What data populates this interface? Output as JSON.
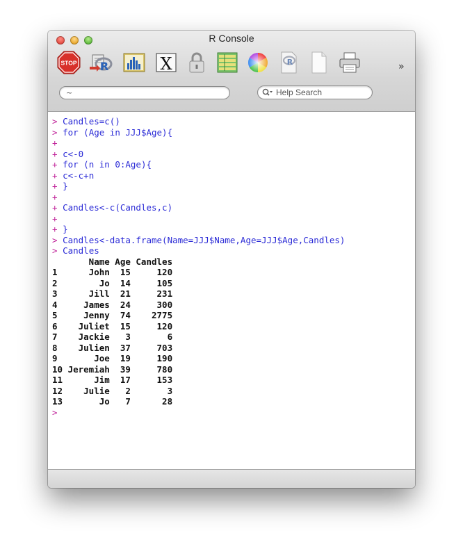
{
  "window": {
    "title": "R Console"
  },
  "toolbar": {
    "overflow_label": "»",
    "buttons": [
      {
        "name": "stop-button",
        "icon": "stop-sign-icon",
        "label": "STOP"
      },
      {
        "name": "source-script-button",
        "icon": "r-script-icon"
      },
      {
        "name": "quartz-button",
        "icon": "chart-icon"
      },
      {
        "name": "x11-button",
        "icon": "x11-icon",
        "label": "X"
      },
      {
        "name": "authorize-button",
        "icon": "lock-icon"
      },
      {
        "name": "data-editor-button",
        "icon": "data-table-icon"
      },
      {
        "name": "color-button",
        "icon": "color-wheel-icon"
      },
      {
        "name": "open-document-button",
        "icon": "r-document-icon"
      },
      {
        "name": "new-document-button",
        "icon": "blank-document-icon"
      },
      {
        "name": "print-button",
        "icon": "printer-icon"
      }
    ]
  },
  "pathbar": {
    "value": "~"
  },
  "search": {
    "placeholder": "Help Search"
  },
  "colors": {
    "prompt": "#c0249a",
    "input": "#2a2ad6",
    "output": "#111111",
    "stop_red": "#d8302a"
  },
  "console": {
    "lines": [
      {
        "prompt": ">",
        "text": "Candles=c()",
        "type": "input"
      },
      {
        "prompt": ">",
        "text": "for (Age in JJJ$Age){",
        "type": "input"
      },
      {
        "prompt": "+",
        "text": "",
        "type": "input"
      },
      {
        "prompt": "+",
        "text": "c<-0",
        "type": "input"
      },
      {
        "prompt": "+",
        "text": "for (n in 0:Age){",
        "type": "input"
      },
      {
        "prompt": "+",
        "text": "c<-c+n",
        "type": "input"
      },
      {
        "prompt": "+",
        "text": "}",
        "type": "input"
      },
      {
        "prompt": "+",
        "text": "",
        "type": "input"
      },
      {
        "prompt": "+",
        "text": "Candles<-c(Candles,c)",
        "type": "input"
      },
      {
        "prompt": "+",
        "text": "",
        "type": "input"
      },
      {
        "prompt": "+",
        "text": "}",
        "type": "input"
      },
      {
        "prompt": ">",
        "text": "Candles<-data.frame(Name=JJJ$Name,Age=JJJ$Age,Candles)",
        "type": "input"
      },
      {
        "prompt": ">",
        "text": "Candles",
        "type": "input"
      },
      {
        "prompt": "",
        "text": "       Name Age Candles",
        "type": "output"
      },
      {
        "prompt": "",
        "text": "1      John  15     120",
        "type": "output"
      },
      {
        "prompt": "",
        "text": "2        Jo  14     105",
        "type": "output"
      },
      {
        "prompt": "",
        "text": "3      Jill  21     231",
        "type": "output"
      },
      {
        "prompt": "",
        "text": "4     James  24     300",
        "type": "output"
      },
      {
        "prompt": "",
        "text": "5     Jenny  74    2775",
        "type": "output"
      },
      {
        "prompt": "",
        "text": "6    Juliet  15     120",
        "type": "output"
      },
      {
        "prompt": "",
        "text": "7    Jackie   3       6",
        "type": "output"
      },
      {
        "prompt": "",
        "text": "8    Julien  37     703",
        "type": "output"
      },
      {
        "prompt": "",
        "text": "9       Joe  19     190",
        "type": "output"
      },
      {
        "prompt": "",
        "text": "10 Jeremiah  39     780",
        "type": "output"
      },
      {
        "prompt": "",
        "text": "11      Jim  17     153",
        "type": "output"
      },
      {
        "prompt": "",
        "text": "12    Julie   2       3",
        "type": "output"
      },
      {
        "prompt": "",
        "text": "13       Jo   7      28",
        "type": "output"
      },
      {
        "prompt": ">",
        "text": "",
        "type": "input"
      }
    ]
  }
}
